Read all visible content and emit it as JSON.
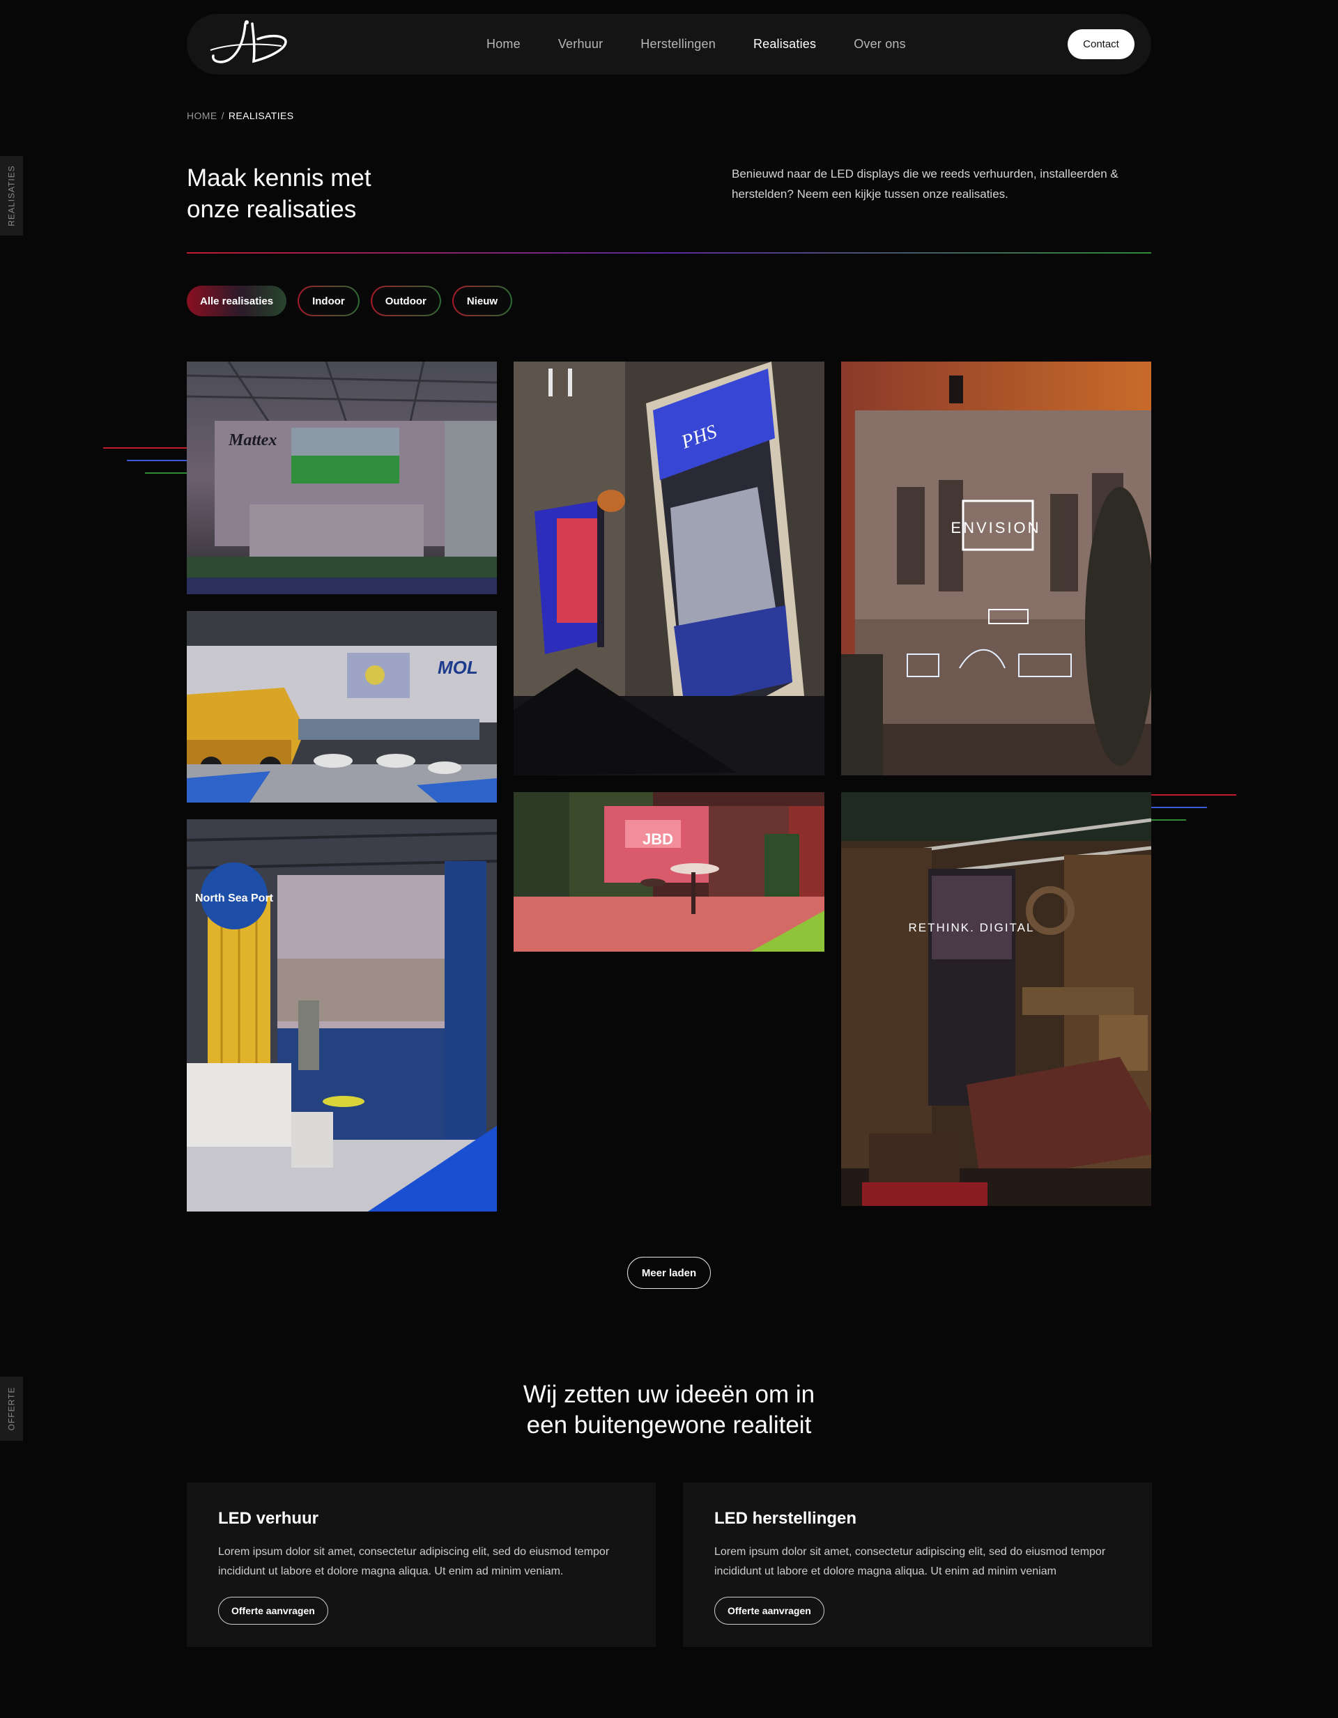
{
  "brand": {
    "logo_text": "JBD ENGINEERING"
  },
  "nav": {
    "items": [
      {
        "label": "Home"
      },
      {
        "label": "Verhuur"
      },
      {
        "label": "Herstellingen"
      },
      {
        "label": "Realisaties",
        "active": true
      },
      {
        "label": "Over ons"
      }
    ],
    "contact_label": "Contact"
  },
  "side_tabs": {
    "top": "REALISATIES",
    "bottom": "OFFERTE"
  },
  "breadcrumb": {
    "home": "HOME",
    "separator": "/",
    "current": "REALISATIES"
  },
  "intro": {
    "title_line1": "Maak kennis met",
    "title_line2": "onze realisaties",
    "text": "Benieuwd naar de LED displays die we reeds verhuurden, installeerden & herstelden? Neem een kijkje tussen onze realisaties."
  },
  "filters": [
    {
      "label": "Alle realisaties",
      "active": true
    },
    {
      "label": "Indoor"
    },
    {
      "label": "Outdoor"
    },
    {
      "label": "Nieuw"
    }
  ],
  "gallery": {
    "items": [
      {
        "brand_text": "Mattex"
      },
      {
        "brand_text": "MOL"
      },
      {
        "brand_text": "North Sea Port"
      },
      {
        "brand_text": "PHS"
      },
      {
        "brand_text": "JBD"
      },
      {
        "brand_text": "ENVISION"
      },
      {
        "brand_text": "RETHINK. DIGITAL"
      }
    ]
  },
  "load_more_label": "Meer laden",
  "cta": {
    "title_line1": "Wij zetten uw ideeën om in",
    "title_line2": "een buitengewone realiteit",
    "cards": [
      {
        "title": "LED verhuur",
        "text": "Lorem ipsum dolor sit amet, consectetur adipiscing elit, sed do eiusmod tempor incididunt ut labore et dolore magna aliqua. Ut enim ad minim veniam.",
        "button": "Offerte aanvragen"
      },
      {
        "title": "LED herstellingen",
        "text": "Lorem ipsum dolor sit amet, consectetur adipiscing elit, sed do eiusmod tempor incididunt ut labore et dolore magna aliqua. Ut enim ad minim veniam",
        "button": "Offerte aanvragen"
      }
    ]
  },
  "colors": {
    "accent_red": "#c11b30",
    "accent_blue": "#3b5bd6",
    "accent_green": "#2f8a34",
    "background": "#080707"
  }
}
